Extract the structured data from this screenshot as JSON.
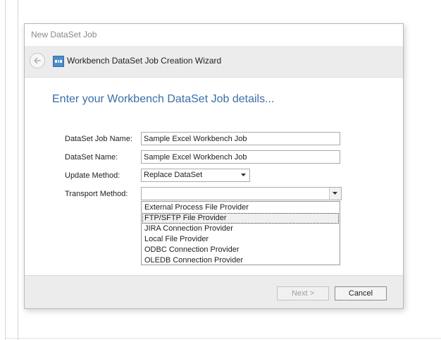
{
  "dialog": {
    "title": "New DataSet Job"
  },
  "wizard": {
    "back_icon": "arrow-left-icon",
    "header_icon": "dataset-wizard-icon",
    "title": "Workbench DataSet Job Creation Wizard",
    "heading": "Enter your Workbench DataSet Job details..."
  },
  "form": {
    "job_name": {
      "label": "DataSet Job Name:",
      "value": "Sample Excel Workbench Job"
    },
    "dataset_name": {
      "label": "DataSet Name:",
      "value": "Sample Excel Workbench Job"
    },
    "update_method": {
      "label": "Update Method:",
      "value": "Replace DataSet"
    },
    "transport_method": {
      "label": "Transport Method:",
      "value": "",
      "options": [
        "External Process File Provider",
        "FTP/SFTP File Provider",
        "JIRA Connection Provider",
        "Local File Provider",
        "ODBC Connection Provider",
        "OLEDB Connection Provider"
      ],
      "hovered_option": "FTP/SFTP File Provider"
    }
  },
  "footer": {
    "next_label": "Next >",
    "cancel_label": "Cancel"
  },
  "colors": {
    "heading": "#3a6ea8",
    "header_band": "#ececec",
    "title_gray": "#888888"
  }
}
